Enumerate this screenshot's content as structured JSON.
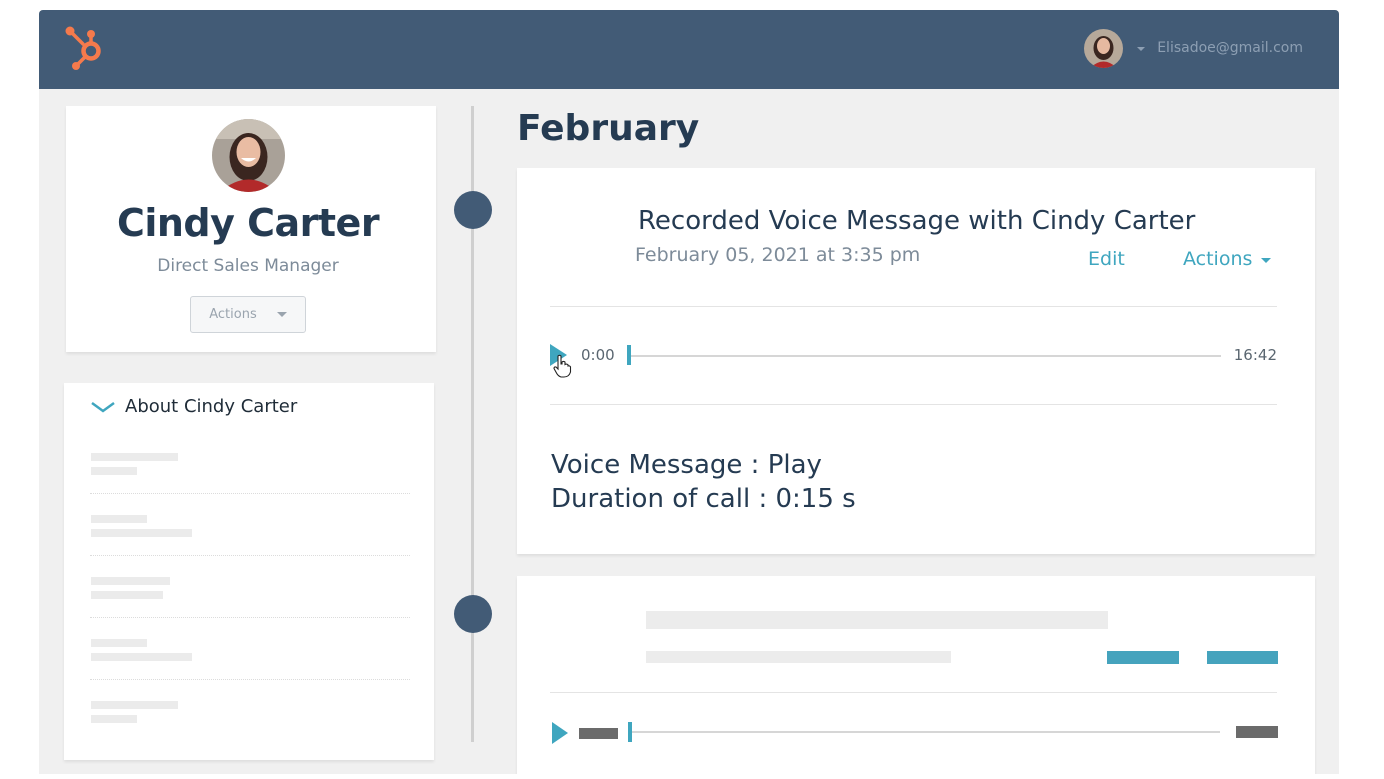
{
  "header": {
    "logo": "hubspot-sprocket-logo",
    "user_email": "Elisadoe@gmail.com",
    "user_avatar": "user-avatar-photo",
    "brand_color": "#425b76",
    "logo_color": "#f57a4c"
  },
  "profile": {
    "name": "Cindy Carter",
    "title": "Direct Sales Manager",
    "actions_label": "Actions",
    "avatar": "profile-photo"
  },
  "about": {
    "title": "About Cindy Carter",
    "icon": "chevron-down-icon",
    "placeholder_rows": 5
  },
  "timeline": {
    "month": "February",
    "events": [
      {
        "title": "Recorded Voice Message with Cindy Carter",
        "date": "February 05, 2021 at 3:35 pm",
        "edit_label": "Edit",
        "actions_label": "Actions",
        "player": {
          "current_time": "0:00",
          "total_time": "16:42",
          "progress": 0
        },
        "body": {
          "line1": "Voice Message : Play",
          "line2": "Duration of call : 0:15 s"
        }
      },
      {
        "placeholder": true,
        "player": {
          "progress": 0
        }
      }
    ]
  },
  "colors": {
    "accent": "#3fa6bf",
    "heading": "#253b52",
    "muted": "#7d8b99",
    "background": "#f0f0f0"
  }
}
